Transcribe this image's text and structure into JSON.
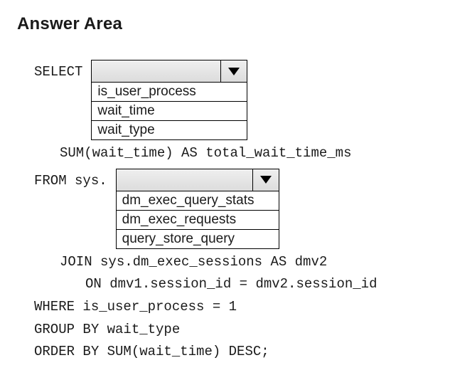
{
  "title": "Answer Area",
  "sql": {
    "select_keyword": "SELECT",
    "from_keyword": "FROM sys.",
    "line2": "SUM(wait_time) AS total_wait_time_ms",
    "line4": "JOIN sys.dm_exec_sessions AS dmv2",
    "line5": "ON dmv1.session_id = dmv2.session_id",
    "line6": "WHERE is_user_process = 1",
    "line7": "GROUP BY wait_type",
    "line8": "ORDER BY SUM(wait_time) DESC;"
  },
  "dropdown1": {
    "selected": "",
    "options": [
      "is_user_process",
      "wait_time",
      "wait_type"
    ]
  },
  "dropdown2": {
    "selected": "",
    "options": [
      "dm_exec_query_stats",
      "dm_exec_requests",
      "query_store_query"
    ]
  }
}
